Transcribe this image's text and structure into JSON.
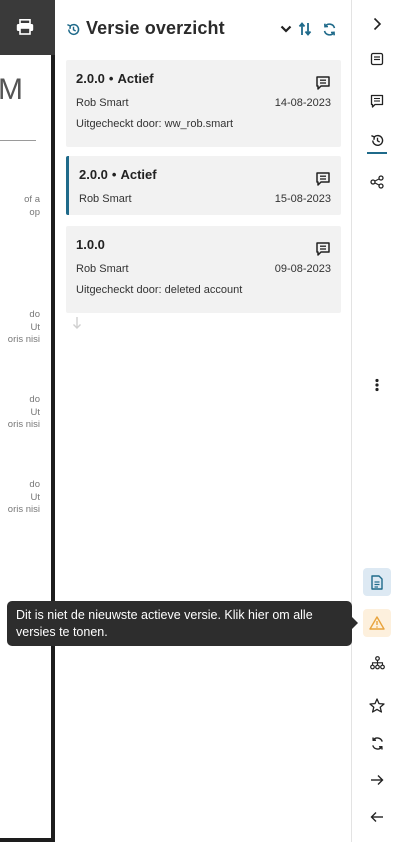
{
  "doc": {
    "big_letter": "M",
    "fragments": [
      {
        "text": "of a\n op"
      },
      {
        "text": "do\n Ut\noris nisi"
      },
      {
        "text": "do\n Ut\noris nisi"
      },
      {
        "text": "do\n Ut\noris nisi"
      }
    ]
  },
  "panel": {
    "title": "Versie overzicht"
  },
  "versions": [
    {
      "version": "2.0.0",
      "status": "Actief",
      "author": "Rob Smart",
      "date": "14-08-2023",
      "checkout": "Uitgecheckt door: ww_rob.smart"
    },
    {
      "version": "2.0.0",
      "status": "Actief",
      "author": "Rob Smart",
      "date": "15-08-2023",
      "checkout": ""
    },
    {
      "version": "1.0.0",
      "status": "",
      "author": "Rob Smart",
      "date": "09-08-2023",
      "checkout": "Uitgecheckt door: deleted account"
    }
  ],
  "tooltip": {
    "text": "Dit is niet de nieuwste actieve versie. Klik hier om alle versies te tonen."
  },
  "colors": {
    "accent": "#1f6a8a",
    "warning": "#e8a33d",
    "tooltip_bg": "#2d2d2d"
  }
}
